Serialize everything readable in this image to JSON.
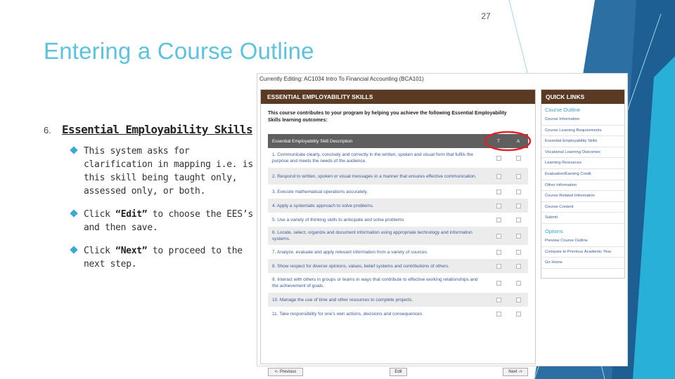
{
  "slide_number": "27",
  "title": "Entering a Course Outline",
  "item": {
    "number": "6.",
    "heading": "Essential Employability Skills"
  },
  "bullets": [
    {
      "pre": "This system asks for clarification in mapping i.e. is this skill being taught only, assessed only, or both.",
      "bold": "",
      "post": ""
    },
    {
      "pre": "Click ",
      "bold": "“Edit”",
      "post": " to choose the EES’s and then save."
    },
    {
      "pre": "Click ",
      "bold": "“Next”",
      "post": " to proceed to the next step."
    }
  ],
  "screenshot": {
    "currently_editing": "Currently Editing: AC1034 Intro To Financial Accounting (BCA101)",
    "main_header": "ESSENTIAL EMPLOYABILITY SKILLS",
    "intro": "This course contributes to your program by helping you achieve the following Essential Employability Skills learning outcomes:",
    "table": {
      "col_desc": "Essential Employability Skill Description",
      "col_t": "T",
      "col_a": "A",
      "rows": [
        "1. Communicate clearly, concisely and correctly in the written, spoken and visual form that fulfils the purpose and meets the needs of the audience.",
        "2. Respond to written, spoken or visual messages in a manner that ensures effective communication.",
        "3. Execute mathematical operations accurately.",
        "4. Apply a systematic approach to solve problems.",
        "5. Use a variety of thinking skills to anticipate and solve problems",
        "6. Locate, select, organize and document information using appropriate technology and information systems.",
        "7. Analyze, evaluate and apply relevant information from a variety of sources.",
        "8. Show respect for diverse opinions, values, belief systems and contributions of others.",
        "9. Interact with others in groups or teams in ways that contribute to effective working relationships and the achievement of goals.",
        "10. Manage the use of time and other resources to complete projects.",
        "11. Take responsibility for one's own actions, decisions and consequences."
      ]
    },
    "buttons": {
      "previous": "<- Previous",
      "edit": "Edit",
      "next": "Next ->"
    },
    "quick_links": {
      "header": "QUICK LINKS",
      "section_course_outline": "Course Outline",
      "links": [
        "Course Information",
        "Course Learning Requirements",
        "Essential Employability Skills",
        "Vocational Learning Outcomes",
        "Learning Resources",
        "Evaluation/Earning Credit",
        "Other Information",
        "Course Related Information",
        "Course Content",
        "Submit"
      ],
      "section_options": "Options",
      "option_links": [
        "Preview Course Outline",
        "Compare to Previous Academic Year",
        "Go Home"
      ]
    }
  },
  "colors": {
    "title": "#5bc3e0",
    "accent": "#3aa8d0",
    "header_brown": "#5a3a22",
    "highlight_red": "#e0202a"
  }
}
